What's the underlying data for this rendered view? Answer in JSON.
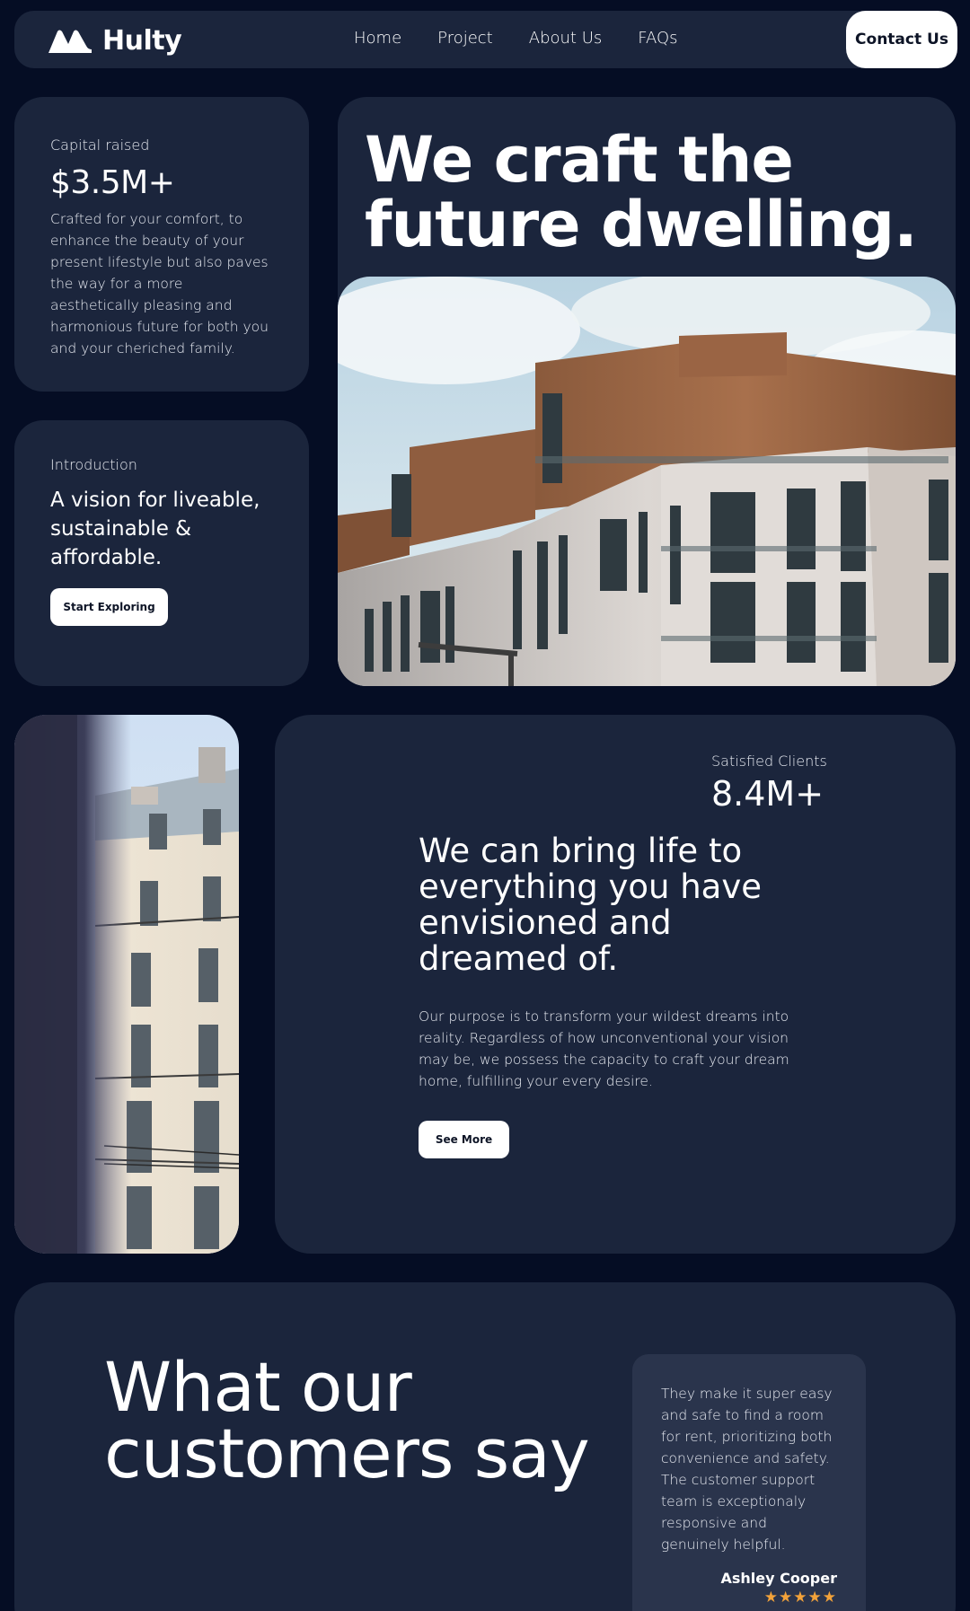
{
  "brand": {
    "name": "Hulty",
    "logo_icon": "hulty-logo-icon"
  },
  "nav": {
    "links": [
      "Home",
      "Project",
      "About Us",
      "FAQs"
    ],
    "contact_label": "Contact Us"
  },
  "capital": {
    "label": "Capital raised",
    "value": "$3.5M+",
    "text": "Crafted for your comfort, to enhance the beauty of your present lifestyle but also paves the way for a more aesthetically pleasing and harmonious future for both you and your cheriched family."
  },
  "intro": {
    "label": "Introduction",
    "title": "A vision for liveable, sustainable & affordable.",
    "button_label": "Start Exploring"
  },
  "hero": {
    "title": "We craft the future dwelling."
  },
  "mission": {
    "clients_label": "Satisfied Clients",
    "clients_value": "8.4M+",
    "title": "We can bring life to everything you have envisioned and dreamed of.",
    "text": "Our purpose is to transform your wildest dreams into reality. Regardless of how unconventional your vision may be, we possess the capacity to craft your dream home, fulfilling your every desire.",
    "button_label": "See More"
  },
  "testimonials": {
    "title": "What our customers say",
    "review": {
      "text": "They make it super easy and safe to find a room for rent, prioritizing both convenience and safety. The customer support team is exceptionaly responsive and genuinely helpful.",
      "author": "Ashley Cooper",
      "rating": 5,
      "stars": "★★★★★"
    }
  },
  "colors": {
    "background": "#050d24",
    "card": "#1b253c",
    "review_card": "#2a344c",
    "star": "#f2a23a"
  }
}
